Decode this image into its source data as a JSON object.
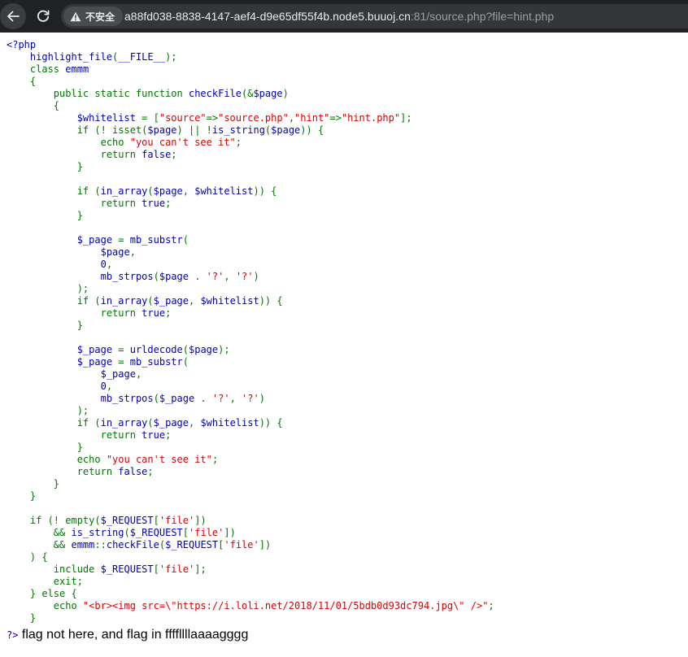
{
  "browser": {
    "security_chip": "不安全",
    "url_host": "a88fd038-8838-4147-aef4-d9e65df55f4b.node5.buuoj.cn",
    "url_rest": ":81/source.php?file=hint.php",
    "icons": [
      "back-arrow-icon",
      "reload-icon",
      "warning-triangle-icon"
    ]
  },
  "colors": {
    "default": "#0000BB",
    "keyword": "#007700",
    "string": "#DD0000",
    "html": "#000000"
  },
  "source": {
    "lines": [
      [
        [
          "default",
          "<?php"
        ]
      ],
      [
        [
          "default",
          "    highlight_file"
        ],
        [
          "keyword",
          "("
        ],
        [
          "default",
          "__FILE__"
        ],
        [
          "keyword",
          ");"
        ]
      ],
      [
        [
          "default",
          "    "
        ],
        [
          "keyword",
          "class "
        ],
        [
          "default",
          "emmm"
        ]
      ],
      [
        [
          "default",
          "    "
        ],
        [
          "keyword",
          "{"
        ]
      ],
      [
        [
          "default",
          "        "
        ],
        [
          "keyword",
          "public static function "
        ],
        [
          "default",
          "checkFile"
        ],
        [
          "keyword",
          "(&"
        ],
        [
          "default",
          "$page"
        ],
        [
          "keyword",
          ")"
        ]
      ],
      [
        [
          "default",
          "        "
        ],
        [
          "keyword",
          "{"
        ]
      ],
      [
        [
          "default",
          "            $whitelist "
        ],
        [
          "keyword",
          "= ["
        ],
        [
          "string",
          "\"source\""
        ],
        [
          "keyword",
          "=>"
        ],
        [
          "string",
          "\"source.php\""
        ],
        [
          "keyword",
          ","
        ],
        [
          "string",
          "\"hint\""
        ],
        [
          "keyword",
          "=>"
        ],
        [
          "string",
          "\"hint.php\""
        ],
        [
          "keyword",
          "];"
        ]
      ],
      [
        [
          "default",
          "            "
        ],
        [
          "keyword",
          "if (! isset("
        ],
        [
          "default",
          "$page"
        ],
        [
          "keyword",
          ") || !"
        ],
        [
          "default",
          "is_string"
        ],
        [
          "keyword",
          "("
        ],
        [
          "default",
          "$page"
        ],
        [
          "keyword",
          ")) {"
        ]
      ],
      [
        [
          "default",
          "                "
        ],
        [
          "keyword",
          "echo "
        ],
        [
          "string",
          "\"you can't see it\""
        ],
        [
          "keyword",
          ";"
        ]
      ],
      [
        [
          "default",
          "                "
        ],
        [
          "keyword",
          "return "
        ],
        [
          "default",
          "false"
        ],
        [
          "keyword",
          ";"
        ]
      ],
      [
        [
          "default",
          "            "
        ],
        [
          "keyword",
          "}"
        ]
      ],
      [],
      [
        [
          "default",
          "            "
        ],
        [
          "keyword",
          "if ("
        ],
        [
          "default",
          "in_array"
        ],
        [
          "keyword",
          "("
        ],
        [
          "default",
          "$page"
        ],
        [
          "keyword",
          ", "
        ],
        [
          "default",
          "$whitelist"
        ],
        [
          "keyword",
          ")) {"
        ]
      ],
      [
        [
          "default",
          "                "
        ],
        [
          "keyword",
          "return "
        ],
        [
          "default",
          "true"
        ],
        [
          "keyword",
          ";"
        ]
      ],
      [
        [
          "default",
          "            "
        ],
        [
          "keyword",
          "}"
        ]
      ],
      [],
      [
        [
          "default",
          "            $_page "
        ],
        [
          "keyword",
          "= "
        ],
        [
          "default",
          "mb_substr"
        ],
        [
          "keyword",
          "("
        ]
      ],
      [
        [
          "default",
          "                $page"
        ],
        [
          "keyword",
          ","
        ]
      ],
      [
        [
          "default",
          "                0"
        ],
        [
          "keyword",
          ","
        ]
      ],
      [
        [
          "default",
          "                mb_strpos"
        ],
        [
          "keyword",
          "("
        ],
        [
          "default",
          "$page "
        ],
        [
          "keyword",
          ". "
        ],
        [
          "string",
          "'?'"
        ],
        [
          "keyword",
          ", "
        ],
        [
          "string",
          "'?'"
        ],
        [
          "keyword",
          ")"
        ]
      ],
      [
        [
          "default",
          "            "
        ],
        [
          "keyword",
          ");"
        ]
      ],
      [
        [
          "default",
          "            "
        ],
        [
          "keyword",
          "if ("
        ],
        [
          "default",
          "in_array"
        ],
        [
          "keyword",
          "("
        ],
        [
          "default",
          "$_page"
        ],
        [
          "keyword",
          ", "
        ],
        [
          "default",
          "$whitelist"
        ],
        [
          "keyword",
          ")) {"
        ]
      ],
      [
        [
          "default",
          "                "
        ],
        [
          "keyword",
          "return "
        ],
        [
          "default",
          "true"
        ],
        [
          "keyword",
          ";"
        ]
      ],
      [
        [
          "default",
          "            "
        ],
        [
          "keyword",
          "}"
        ]
      ],
      [],
      [
        [
          "default",
          "            $_page "
        ],
        [
          "keyword",
          "= "
        ],
        [
          "default",
          "urldecode"
        ],
        [
          "keyword",
          "("
        ],
        [
          "default",
          "$page"
        ],
        [
          "keyword",
          ");"
        ]
      ],
      [
        [
          "default",
          "            $_page "
        ],
        [
          "keyword",
          "= "
        ],
        [
          "default",
          "mb_substr"
        ],
        [
          "keyword",
          "("
        ]
      ],
      [
        [
          "default",
          "                $_page"
        ],
        [
          "keyword",
          ","
        ]
      ],
      [
        [
          "default",
          "                0"
        ],
        [
          "keyword",
          ","
        ]
      ],
      [
        [
          "default",
          "                mb_strpos"
        ],
        [
          "keyword",
          "("
        ],
        [
          "default",
          "$_page "
        ],
        [
          "keyword",
          ". "
        ],
        [
          "string",
          "'?'"
        ],
        [
          "keyword",
          ", "
        ],
        [
          "string",
          "'?'"
        ],
        [
          "keyword",
          ")"
        ]
      ],
      [
        [
          "default",
          "            "
        ],
        [
          "keyword",
          ");"
        ]
      ],
      [
        [
          "default",
          "            "
        ],
        [
          "keyword",
          "if ("
        ],
        [
          "default",
          "in_array"
        ],
        [
          "keyword",
          "("
        ],
        [
          "default",
          "$_page"
        ],
        [
          "keyword",
          ", "
        ],
        [
          "default",
          "$whitelist"
        ],
        [
          "keyword",
          ")) {"
        ]
      ],
      [
        [
          "default",
          "                "
        ],
        [
          "keyword",
          "return "
        ],
        [
          "default",
          "true"
        ],
        [
          "keyword",
          ";"
        ]
      ],
      [
        [
          "default",
          "            "
        ],
        [
          "keyword",
          "}"
        ]
      ],
      [
        [
          "default",
          "            "
        ],
        [
          "keyword",
          "echo "
        ],
        [
          "string",
          "\"you can't see it\""
        ],
        [
          "keyword",
          ";"
        ]
      ],
      [
        [
          "default",
          "            "
        ],
        [
          "keyword",
          "return "
        ],
        [
          "default",
          "false"
        ],
        [
          "keyword",
          ";"
        ]
      ],
      [
        [
          "default",
          "        "
        ],
        [
          "keyword",
          "}"
        ]
      ],
      [
        [
          "default",
          "    "
        ],
        [
          "keyword",
          "}"
        ]
      ],
      [],
      [
        [
          "default",
          "    "
        ],
        [
          "keyword",
          "if (! empty("
        ],
        [
          "default",
          "$_REQUEST"
        ],
        [
          "keyword",
          "["
        ],
        [
          "string",
          "'file'"
        ],
        [
          "keyword",
          "])"
        ]
      ],
      [
        [
          "default",
          "        "
        ],
        [
          "keyword",
          "&& "
        ],
        [
          "default",
          "is_string"
        ],
        [
          "keyword",
          "("
        ],
        [
          "default",
          "$_REQUEST"
        ],
        [
          "keyword",
          "["
        ],
        [
          "string",
          "'file'"
        ],
        [
          "keyword",
          "])"
        ]
      ],
      [
        [
          "default",
          "        "
        ],
        [
          "keyword",
          "&& "
        ],
        [
          "default",
          "emmm"
        ],
        [
          "keyword",
          "::"
        ],
        [
          "default",
          "checkFile"
        ],
        [
          "keyword",
          "("
        ],
        [
          "default",
          "$_REQUEST"
        ],
        [
          "keyword",
          "["
        ],
        [
          "string",
          "'file'"
        ],
        [
          "keyword",
          "])"
        ]
      ],
      [
        [
          "default",
          "    "
        ],
        [
          "keyword",
          ") {"
        ]
      ],
      [
        [
          "default",
          "        "
        ],
        [
          "keyword",
          "include "
        ],
        [
          "default",
          "$_REQUEST"
        ],
        [
          "keyword",
          "["
        ],
        [
          "string",
          "'file'"
        ],
        [
          "keyword",
          "];"
        ]
      ],
      [
        [
          "default",
          "        "
        ],
        [
          "keyword",
          "exit;"
        ]
      ],
      [
        [
          "default",
          "    "
        ],
        [
          "keyword",
          "} else {"
        ]
      ],
      [
        [
          "default",
          "        "
        ],
        [
          "keyword",
          "echo "
        ],
        [
          "string",
          "\"<br><img src=\\\"https://i.loli.net/2018/11/01/5bdb0d93dc794.jpg\\\" />\""
        ],
        [
          "keyword",
          ";"
        ]
      ],
      [
        [
          "default",
          "    "
        ],
        [
          "keyword",
          "}"
        ]
      ]
    ]
  },
  "output": {
    "close_tag": "?>",
    "message": "flag not here, and flag in ffffllllaaaagggg"
  }
}
